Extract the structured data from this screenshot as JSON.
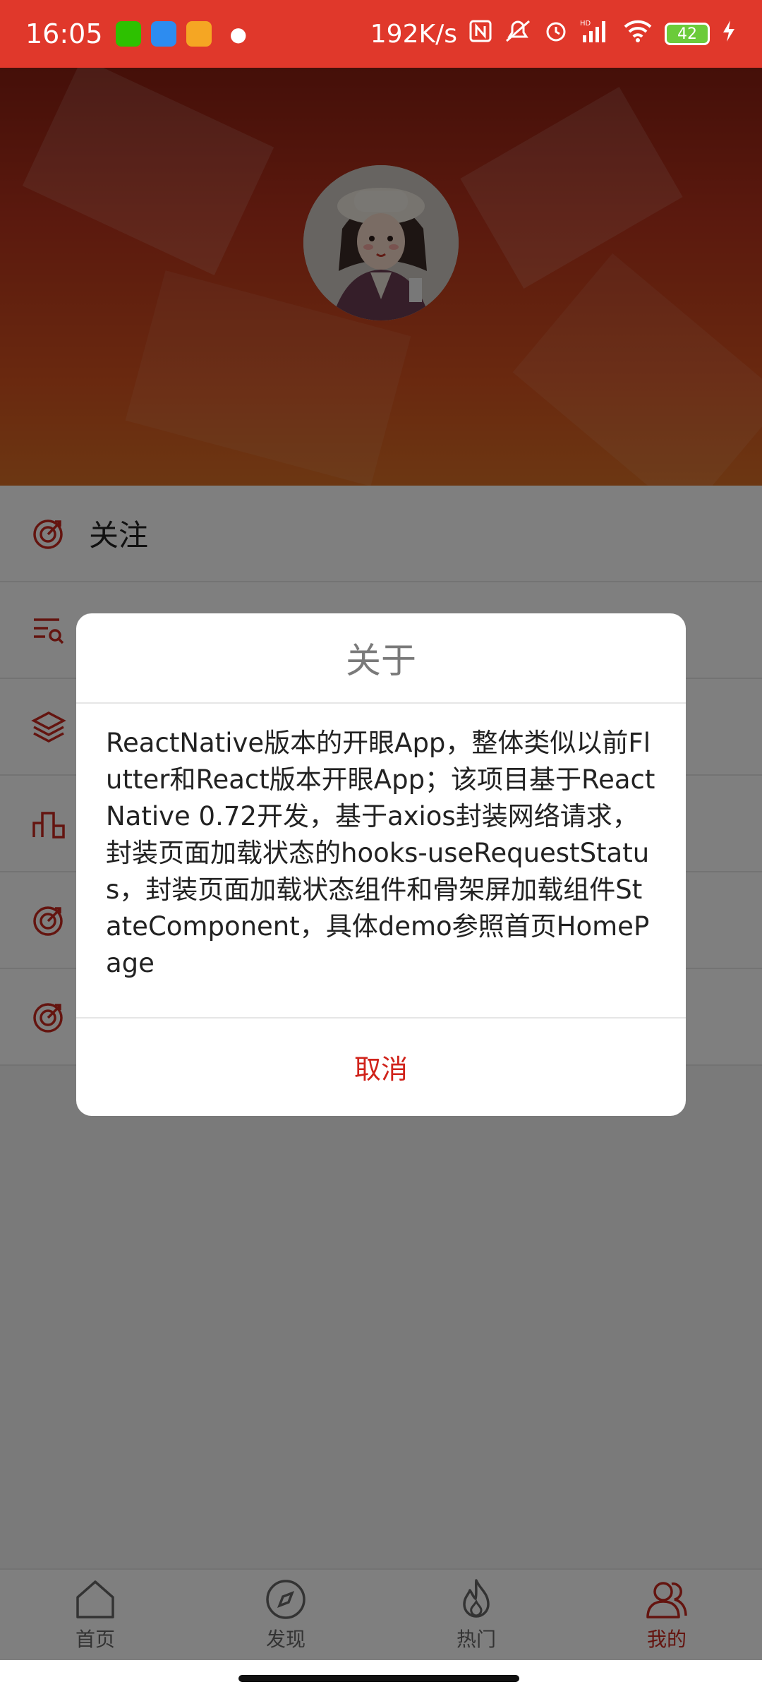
{
  "status_bar": {
    "time": "16:05",
    "net_speed": "192K/s",
    "battery": "42",
    "hd_label": "HD"
  },
  "menu": {
    "items": [
      {
        "label": "关注",
        "icon": "target-icon"
      },
      {
        "label": "",
        "icon": "list-search-icon"
      },
      {
        "label": "",
        "icon": "layers-icon"
      },
      {
        "label": "",
        "icon": "podium-icon"
      },
      {
        "label": "",
        "icon": "target-icon"
      },
      {
        "label": "",
        "icon": "target-icon"
      }
    ]
  },
  "dialog": {
    "title": "关于",
    "body": "ReactNative版本的开眼App，整体类似以前Flutter和React版本开眼App；该项目基于ReactNative 0.72开发，基于axios封装网络请求，封装页面加载状态的hooks-useRequestStatus，封装页面加载状态组件和骨架屏加载组件StateComponent，具体demo参照首页HomePage",
    "cancel_label": "取消"
  },
  "tab_bar": {
    "tabs": [
      {
        "label": "首页",
        "icon": "home-icon",
        "active": false
      },
      {
        "label": "发现",
        "icon": "compass-icon",
        "active": false
      },
      {
        "label": "热门",
        "icon": "flame-icon",
        "active": false
      },
      {
        "label": "我的",
        "icon": "users-icon",
        "active": true
      }
    ]
  },
  "colors": {
    "accent": "#c8281e",
    "status_bar": "#e0382b"
  }
}
